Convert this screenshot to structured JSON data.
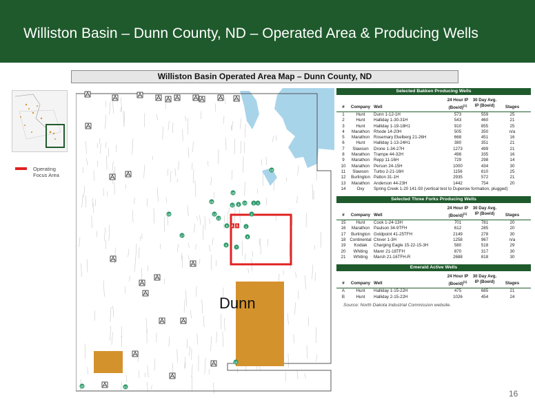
{
  "header": {
    "title": "Williston Basin – Dunn County, ND – Operated Area & Producing Wells"
  },
  "map_title": "Williston Basin Operated Area Map – Dunn County, ND",
  "legend": {
    "label": "Operating Focus Area",
    "color": "#e02020"
  },
  "map": {
    "county_label": "Dunn",
    "acreage_color": "#d4922c",
    "well_marker_color": "#2e9b6b",
    "well_labels": [
      "1",
      "2",
      "3",
      "4",
      "5",
      "6",
      "7",
      "8",
      "9",
      "10",
      "11",
      "12",
      "13",
      "14",
      "15",
      "16",
      "17",
      "18",
      "19",
      "20",
      "21"
    ],
    "emerald_labels": [
      "A",
      "B"
    ]
  },
  "columns": {
    "num": "#",
    "company": "Company",
    "well": "Well",
    "ip": "24 Hour IP (Boe/d)",
    "ip_footnote": "(1)",
    "avg": "30 Day Avg. IP (Boe/d)",
    "stages": "Stages"
  },
  "tables": [
    {
      "title": "Selected Bakken Producing Wells",
      "rows": [
        [
          "1",
          "Hunt",
          "Dunn 1-12-1H",
          "573",
          "559",
          "25"
        ],
        [
          "2",
          "Hunt",
          "Halliday 1-30-31H",
          "543",
          "460",
          "21"
        ],
        [
          "3",
          "Hunt",
          "Halliday 1-19-18H1",
          "910",
          "855",
          "25"
        ],
        [
          "4",
          "Marathon",
          "Rhode 14-20H",
          "505",
          "350",
          "n/a"
        ],
        [
          "5",
          "Marathon",
          "Rosemary Ekelberg 21-26H",
          "668",
          "451",
          "16"
        ],
        [
          "6",
          "Hunt",
          "Halliday 1-13-24H1",
          "380",
          "351",
          "21"
        ],
        [
          "7",
          "Slawson",
          "Drone 1-34-27H",
          "1273",
          "499",
          "21"
        ],
        [
          "8",
          "Marathon",
          "Trampe 44-32H",
          "498",
          "335",
          "16"
        ],
        [
          "9",
          "Marathon",
          "Repp 11-16H",
          "729",
          "298",
          "14"
        ],
        [
          "10",
          "Marathon",
          "Person 24-15H",
          "1000",
          "434",
          "30"
        ],
        [
          "11",
          "Slawson",
          "Turbo 2-21-16H",
          "1156",
          "610",
          "25"
        ],
        [
          "12",
          "Burlington",
          "Patton 31-1H",
          "2935",
          "572",
          "21"
        ],
        [
          "13",
          "Marathon",
          "Anderson 44-23H",
          "1442",
          "754",
          "20"
        ],
        [
          "14",
          "Oxy",
          "Spring Creek 1-20 141-93 (vertical test to Duperow formation, plugged)",
          "",
          "",
          ""
        ]
      ]
    },
    {
      "title": "Selected Three Forks Producing Wells",
      "rows": [
        [
          "15",
          "Hunt",
          "Cook 1-24-13H",
          "701",
          "781",
          "20"
        ],
        [
          "16",
          "Marathon",
          "Paulson 34-9TFH",
          "612",
          "285",
          "20"
        ],
        [
          "17",
          "Burlington",
          "Goldpoint 41-25TFH",
          "2149",
          "278",
          "30"
        ],
        [
          "18",
          "Continental",
          "Clover 1-3H",
          "1258",
          "967",
          "n/a"
        ],
        [
          "19",
          "Kodiak",
          "Charging Eagle 15-22-15-3H",
          "580",
          "518",
          "29"
        ],
        [
          "20",
          "Whiting",
          "Mann 21-18TFH",
          "870",
          "317",
          "30"
        ],
        [
          "21",
          "Whiting",
          "Marsh 21-16TFH-R",
          "2688",
          "818",
          "30"
        ]
      ]
    },
    {
      "title": "Emerald Active Wells",
      "rows": [
        [
          "A",
          "Hunt",
          "Halliday 1-15-22H",
          "475",
          "685",
          "21"
        ],
        [
          "B",
          "Hunt",
          "Halliday 2-15-22H",
          "1026",
          "454",
          "24"
        ]
      ]
    }
  ],
  "source": "Source: North Dakota Industrial Commission website.",
  "page_number": "16"
}
